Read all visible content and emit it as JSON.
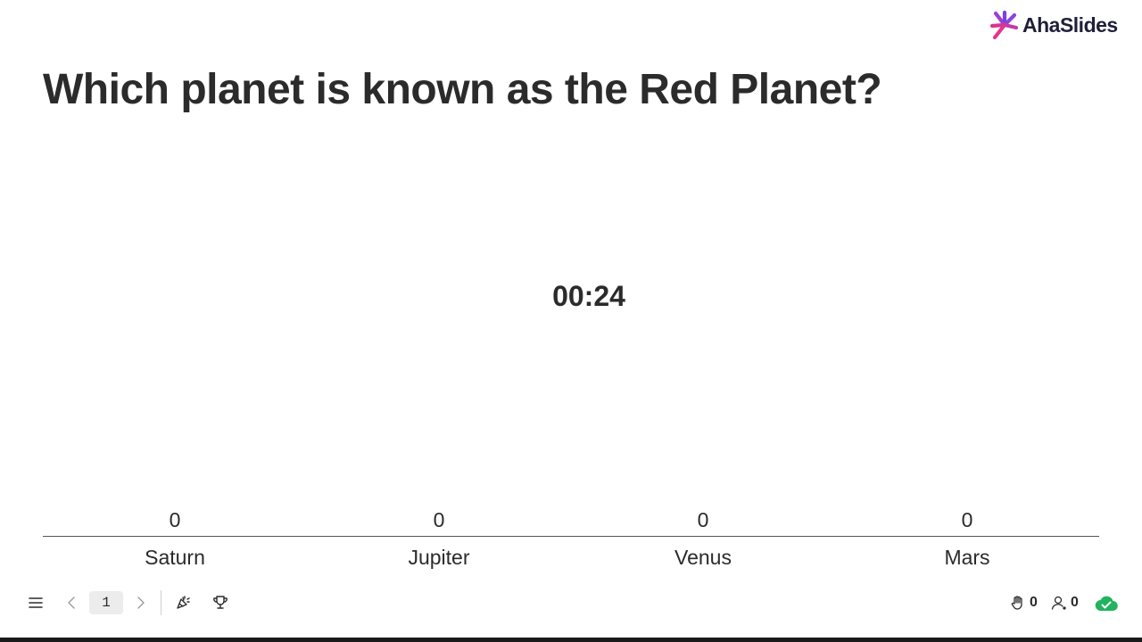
{
  "brand": {
    "name": "AhaSlides",
    "accent_pink": "#e8338c",
    "accent_purple": "#7b3fe4"
  },
  "question": {
    "title": "Which planet is known as the Red Planet?"
  },
  "timer": {
    "text": "00:24"
  },
  "chart_data": {
    "type": "bar",
    "categories": [
      "Saturn",
      "Jupiter",
      "Venus",
      "Mars"
    ],
    "values": [
      0,
      0,
      0,
      0
    ]
  },
  "toolbar": {
    "menu_icon": "hamburger-icon",
    "prev_icon": "chevron-left-icon",
    "current_slide": "1",
    "next_icon": "chevron-right-icon",
    "confetti_icon": "party-popper-icon",
    "leaderboard_icon": "trophy-icon"
  },
  "status": {
    "hand_icon": "raised-hand-icon",
    "raised_hands": "0",
    "user_icon": "participant-icon",
    "participants": "0",
    "cloud_icon": "cloud-check-icon",
    "cloud_color": "#22b35e"
  }
}
